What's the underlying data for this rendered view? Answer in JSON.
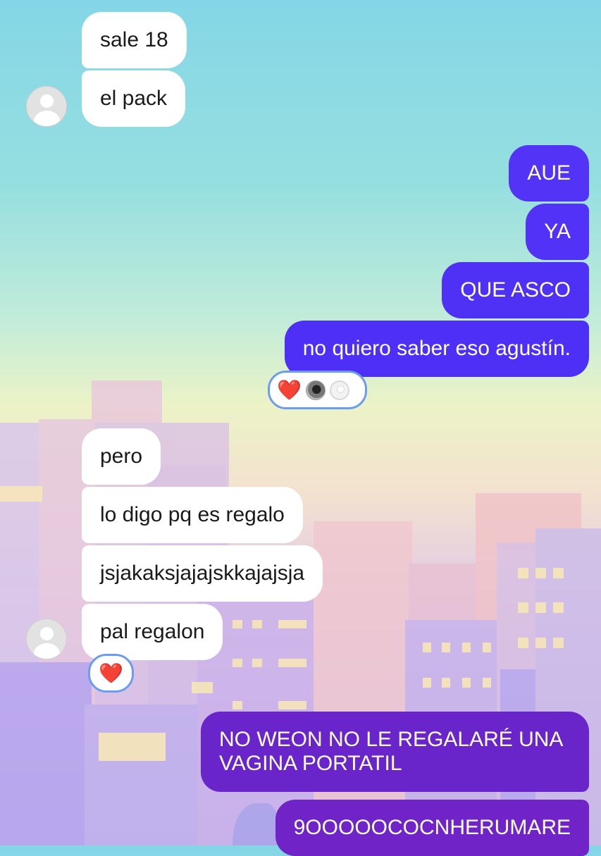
{
  "chat": {
    "incoming_group_1": [
      "sale 18",
      "el pack"
    ],
    "outgoing_group_1": [
      "AUE",
      "YA",
      "QUE ASCO",
      "no quiero saber eso agustín."
    ],
    "reaction_1": {
      "emoji": "❤️",
      "reactors": [
        "heart",
        "user-photo",
        "default-avatar"
      ]
    },
    "incoming_group_2": [
      "pero",
      "lo digo pq es regalo",
      "jsjakaksjajajskkajajsja",
      "pal regalon"
    ],
    "reaction_2": {
      "emoji": "❤️"
    },
    "outgoing_group_2": [
      "NO WEON NO LE REGALARÉ UNA VAGINA PORTATIL",
      "9OOOOOCOCNHERUMARE"
    ]
  },
  "colors": {
    "incoming_bubble": "#ffffff",
    "outgoing_blue": "#4a2ff5",
    "outgoing_purple": "#7024c8",
    "reaction_border": "#6b9cf0",
    "heart": "#e0202e"
  },
  "icons": [
    "default-avatar-icon",
    "heart-icon"
  ]
}
